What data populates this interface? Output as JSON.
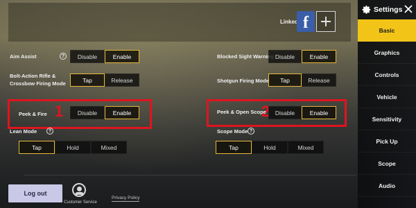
{
  "header": {
    "linked_label": "Linked",
    "facebook_glyph": "f"
  },
  "settings": {
    "aim_assist": {
      "label": "Aim Assist",
      "help": "?",
      "options": [
        "Disable",
        "Enable"
      ],
      "selected": "Enable"
    },
    "blocked_sight": {
      "label": "Blocked Sight Warning",
      "options": [
        "Disable",
        "Enable"
      ],
      "selected": "Enable"
    },
    "bolt_action": {
      "label_line1": "Bolt-Action Rifle &",
      "label_line2": "Crossbow Firing Mode",
      "options": [
        "Tap",
        "Release"
      ],
      "selected": "Tap"
    },
    "shotgun": {
      "label": "Shotgun Firing Mode",
      "options": [
        "Tap",
        "Release"
      ],
      "selected": "Tap"
    },
    "peek_fire": {
      "label": "Peek & Fire",
      "options": [
        "Disable",
        "Enable"
      ],
      "selected": "Enable"
    },
    "peek_scope": {
      "label": "Peek & Open Scope",
      "options": [
        "Disable",
        "Enable"
      ],
      "selected": "Enable"
    },
    "lean_mode": {
      "label": "Lean Mode",
      "help": "?",
      "options": [
        "Tap",
        "Hold",
        "Mixed"
      ],
      "selected": "Tap"
    },
    "scope_mode": {
      "label": "Scope Mode",
      "help": "?",
      "options": [
        "Tap",
        "Hold",
        "Mixed"
      ],
      "selected": "Tap"
    }
  },
  "annotations": {
    "box1": "1",
    "box2": "2",
    "color": "#e0141f"
  },
  "footer": {
    "logout": "Log out",
    "customer_service": "Customer Service",
    "privacy_policy": "Privacy Policy"
  },
  "sidebar": {
    "title": "Settings",
    "items": [
      {
        "label": "Basic",
        "active": true
      },
      {
        "label": "Graphics",
        "active": false
      },
      {
        "label": "Controls",
        "active": false
      },
      {
        "label": "Vehicle",
        "active": false
      },
      {
        "label": "Sensitivity",
        "active": false
      },
      {
        "label": "Pick Up",
        "active": false
      },
      {
        "label": "Scope",
        "active": false
      },
      {
        "label": "Audio",
        "active": false
      }
    ]
  },
  "colors": {
    "accent": "#f2c417",
    "selected_border": "#e8b93a",
    "facebook": "#3b5ea8",
    "logout_bg": "#c9c8e6"
  }
}
